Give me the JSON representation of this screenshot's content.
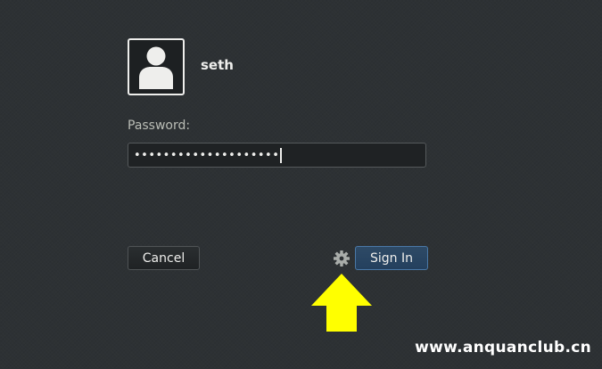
{
  "user": {
    "name": "seth",
    "avatar_icon": "person-silhouette-icon"
  },
  "password": {
    "label": "Password:",
    "masked_value": "••••••••••••••••••••"
  },
  "buttons": {
    "cancel_label": "Cancel",
    "signin_label": "Sign In"
  },
  "session_menu": {
    "icon": "gear-icon"
  },
  "annotation": {
    "icon": "up-arrow-icon",
    "color": "#ffff00"
  },
  "watermark": {
    "text": "www.anquanclub.cn"
  },
  "colors": {
    "background": "#2d3134",
    "text": "#eeeeec",
    "signin_accent": "#24405e"
  }
}
